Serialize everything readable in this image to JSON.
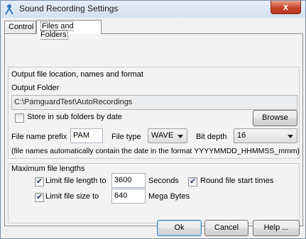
{
  "window": {
    "title": "Sound Recording Settings",
    "close_label": "x"
  },
  "tabs": [
    {
      "label": "Control"
    },
    {
      "label": "Files and Folders"
    }
  ],
  "output_group": {
    "title": "Output file location, names and format",
    "folder_label": "Output Folder",
    "folder_value": "C:\\PamguardTest\\AutoRecordings",
    "subfolders_label": "Store in sub folders by date",
    "subfolders_checked": false,
    "browse_label": "Browse",
    "prefix_label": "File name prefix",
    "prefix_value": "PAM",
    "filetype_label": "File type",
    "filetype_value": "WAVE",
    "bitdepth_label": "Bit depth",
    "bitdepth_value": "16",
    "note": "(file names automatically contain the date in the format YYYYMMDD_HHMMSS_mmm)"
  },
  "length_group": {
    "title": "Maximum file lengths",
    "limit_length_label": "Limit file length to",
    "limit_length_checked": true,
    "length_value": "3600",
    "length_unit": "Seconds",
    "round_label": "Round file start times",
    "round_checked": true,
    "limit_size_label": "Limit file size to",
    "limit_size_checked": true,
    "size_value": "640",
    "size_unit": "Mega Bytes"
  },
  "buttons": {
    "ok": "Ok",
    "cancel": "Cancel",
    "help": "Help ..."
  }
}
